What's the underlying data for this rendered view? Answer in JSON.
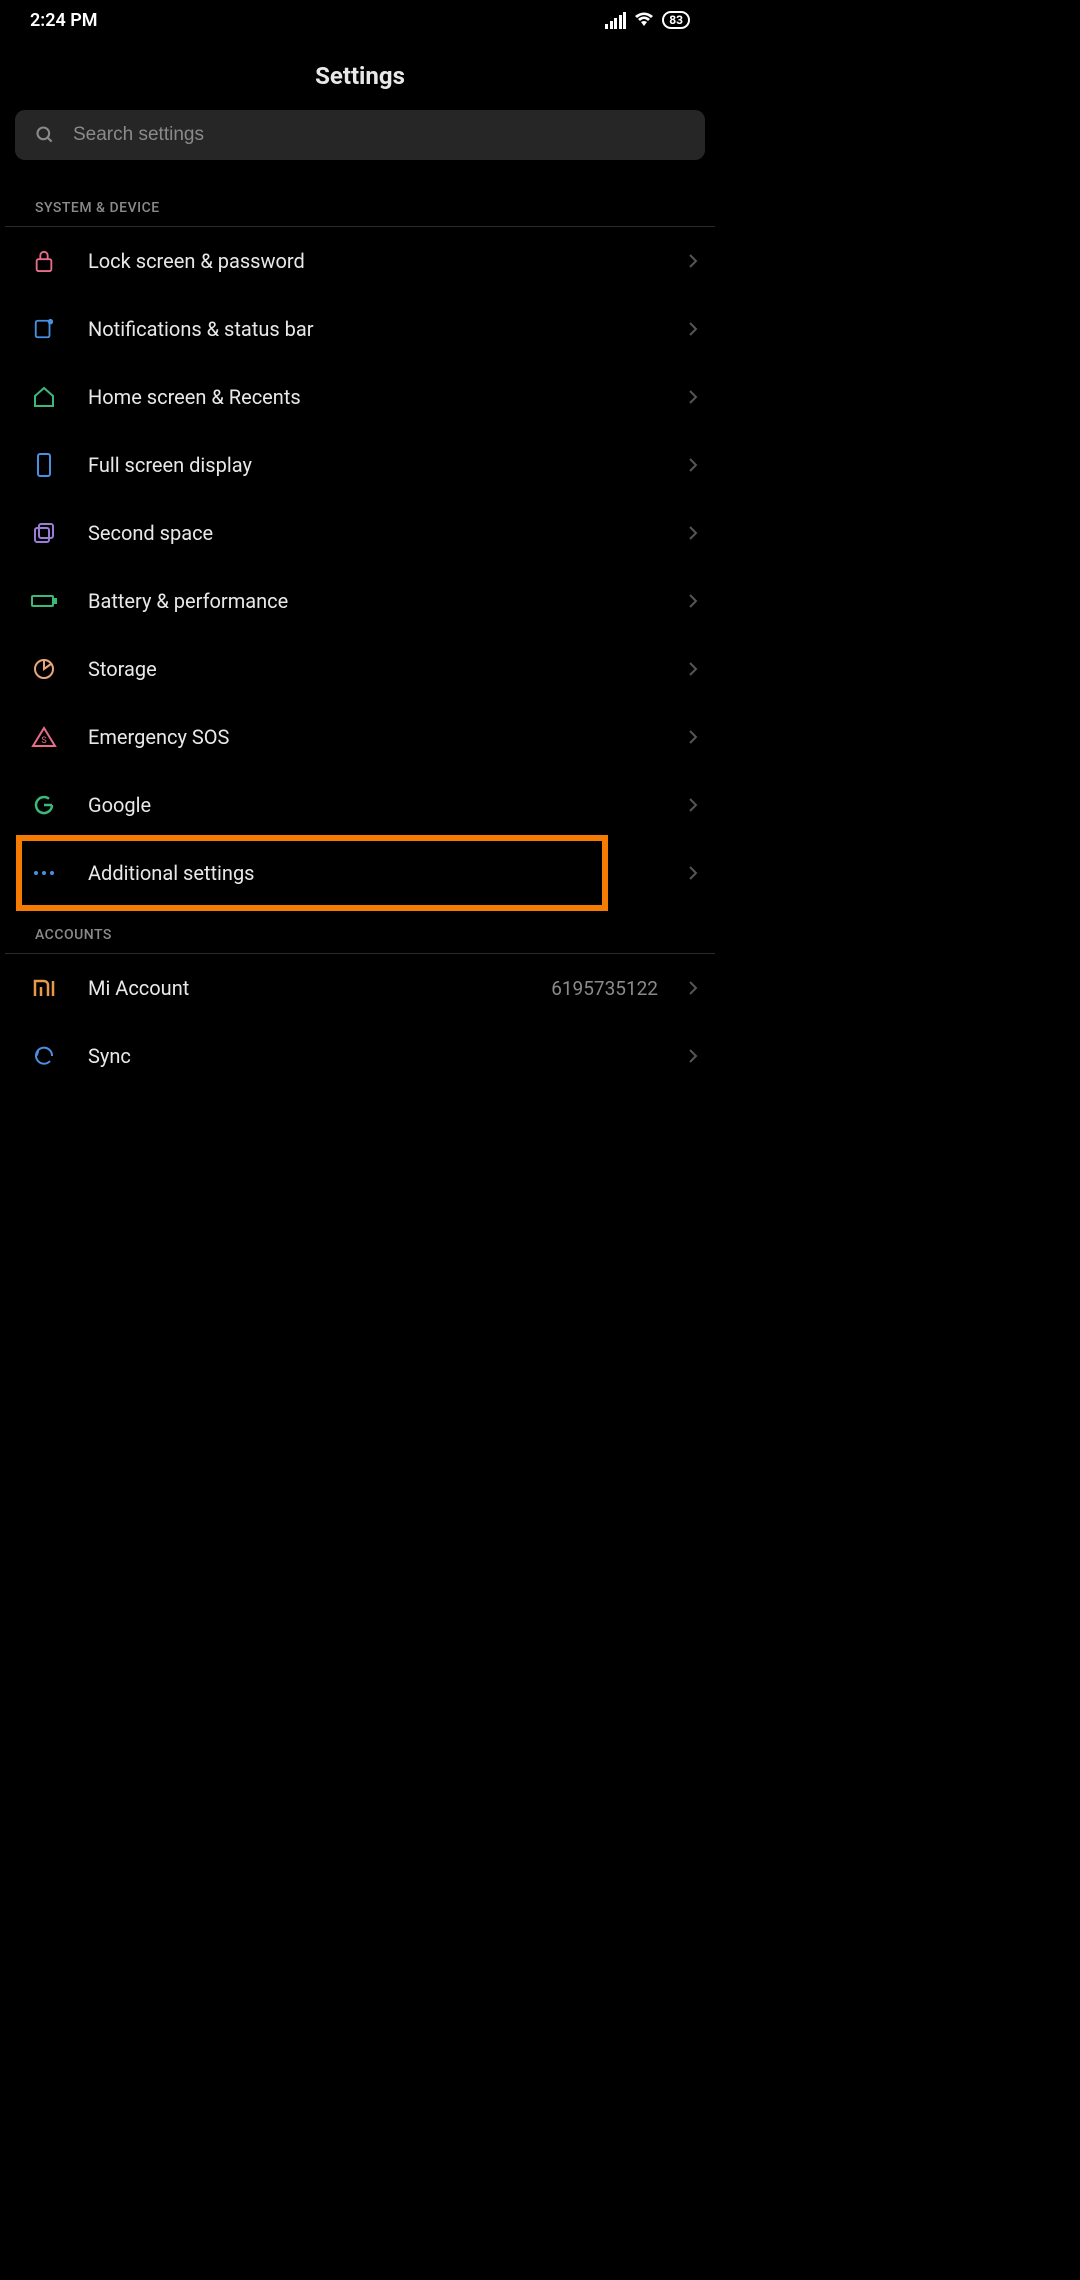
{
  "status_bar": {
    "time": "2:24 PM",
    "battery": "83"
  },
  "header": {
    "title": "Settings"
  },
  "search": {
    "placeholder": "Search settings"
  },
  "sections": [
    {
      "title": "SYSTEM & DEVICE",
      "items": [
        {
          "id": "lock-screen",
          "label": "Lock screen & password",
          "icon": "lock-icon",
          "color": "#e86d8a"
        },
        {
          "id": "notifications",
          "label": "Notifications & status bar",
          "icon": "notification-icon",
          "color": "#4a90e2"
        },
        {
          "id": "home-screen",
          "label": "Home screen & Recents",
          "icon": "home-icon",
          "color": "#3cb878"
        },
        {
          "id": "full-screen",
          "label": "Full screen display",
          "icon": "phone-icon",
          "color": "#4a90e2"
        },
        {
          "id": "second-space",
          "label": "Second space",
          "icon": "layers-icon",
          "color": "#9b7dd8"
        },
        {
          "id": "battery",
          "label": "Battery & performance",
          "icon": "battery-icon",
          "color": "#3cb878"
        },
        {
          "id": "storage",
          "label": "Storage",
          "icon": "pie-icon",
          "color": "#e8a87c"
        },
        {
          "id": "emergency",
          "label": "Emergency SOS",
          "icon": "alert-icon",
          "color": "#e86d8a"
        },
        {
          "id": "google",
          "label": "Google",
          "icon": "google-icon",
          "color": "#3cb878"
        },
        {
          "id": "additional",
          "label": "Additional settings",
          "icon": "dots-icon",
          "color": "#4a90e2",
          "highlighted": true
        }
      ]
    },
    {
      "title": "ACCOUNTS",
      "items": [
        {
          "id": "mi-account",
          "label": "Mi Account",
          "icon": "mi-icon",
          "color": "#e89a4a",
          "value": "6195735122"
        },
        {
          "id": "sync",
          "label": "Sync",
          "icon": "sync-icon",
          "color": "#4a90e2"
        }
      ]
    }
  ]
}
